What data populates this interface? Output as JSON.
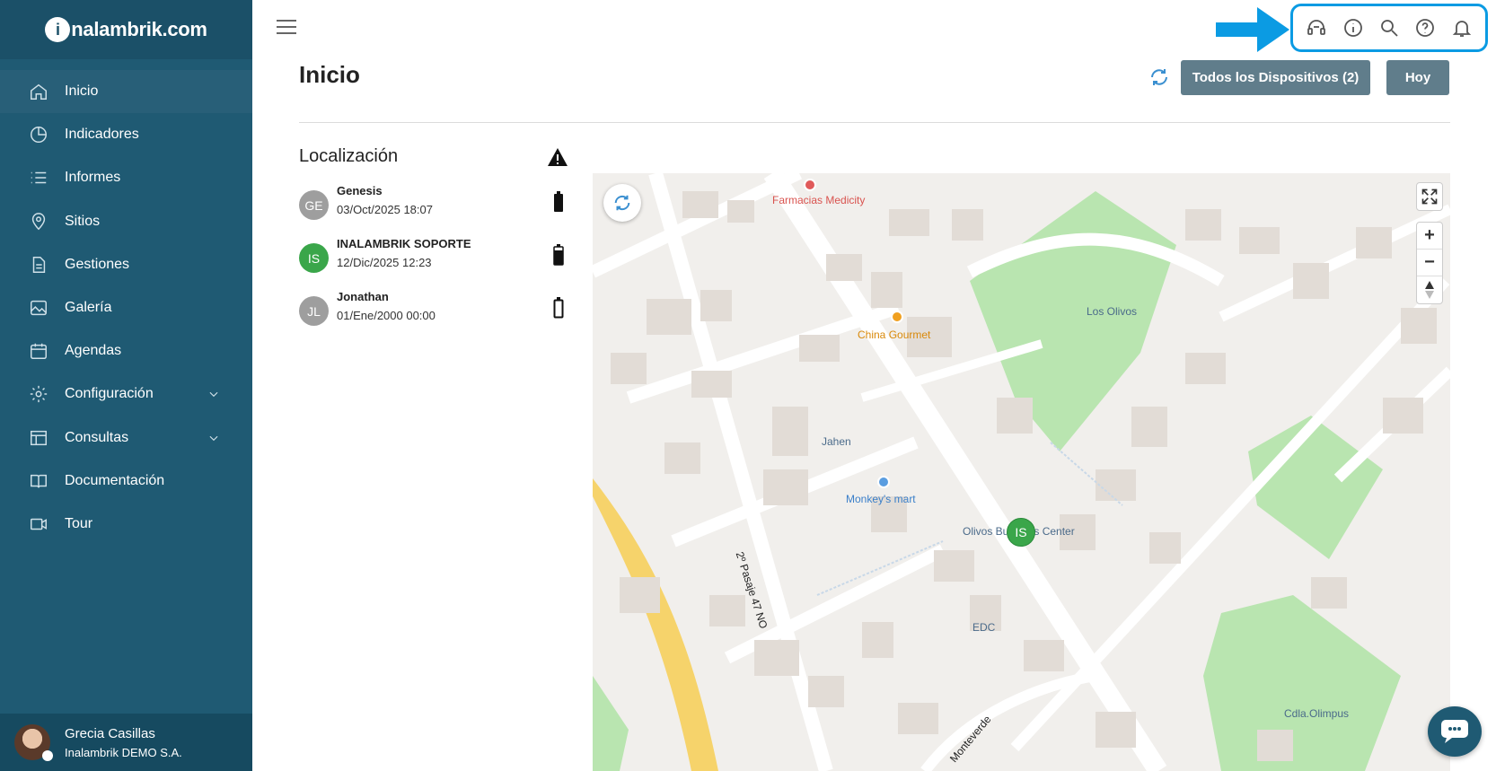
{
  "brand": {
    "logo_letter": "i",
    "text": "nalambrik.com"
  },
  "sidebar": {
    "items": [
      {
        "label": "Inicio",
        "icon": "home-icon"
      },
      {
        "label": "Indicadores",
        "icon": "pie-chart-icon"
      },
      {
        "label": "Informes",
        "icon": "list-icon"
      },
      {
        "label": "Sitios",
        "icon": "map-pin-icon"
      },
      {
        "label": "Gestiones",
        "icon": "document-icon"
      },
      {
        "label": "Galería",
        "icon": "image-icon"
      },
      {
        "label": "Agendas",
        "icon": "calendar-icon"
      },
      {
        "label": "Configuración",
        "icon": "gear-icon"
      },
      {
        "label": "Consultas",
        "icon": "table-icon"
      },
      {
        "label": "Documentación",
        "icon": "book-icon"
      },
      {
        "label": "Tour",
        "icon": "video-icon"
      }
    ]
  },
  "user": {
    "name": "Grecia Casillas",
    "company": "Inalambrik DEMO S.A."
  },
  "header": {
    "title": "Inicio",
    "devices_button": "Todos los Dispositivos (2)",
    "today_button": "Hoy"
  },
  "top_icons": [
    "support-icon",
    "info-icon",
    "search-icon",
    "help-icon",
    "bell-icon"
  ],
  "location": {
    "title": "Localización",
    "devices": [
      {
        "initials": "GE",
        "name": "Genesis",
        "time": "03/Oct/2025 18:07",
        "color": "#9e9e9e",
        "battery": 0.85
      },
      {
        "initials": "IS",
        "name": "INALAMBRIK SOPORTE",
        "time": "12/Dic/2025 12:23",
        "color": "#3aa64a",
        "battery": 0.8
      },
      {
        "initials": "JL",
        "name": "Jonathan",
        "time": "01/Ene/2000 00:00",
        "color": "#9e9e9e",
        "battery": 0.0
      }
    ]
  },
  "map": {
    "labels": {
      "pharmacy": "Farmacias Medicity",
      "restaurant": "China Gourmet",
      "park": "Los Olivos",
      "jahen": "Jahen",
      "market": "Monkey's mart",
      "business": "Olivos Business Center",
      "street": "2º Pasaje 47 NO",
      "edc": "EDC",
      "cdla": "Cdla.Olimpus",
      "monteverde": "Monteverde"
    },
    "marker_initials": "IS"
  },
  "colors": {
    "sidebar": "#1f5a73",
    "button": "#607d8b",
    "accent": "#0b9be3"
  }
}
